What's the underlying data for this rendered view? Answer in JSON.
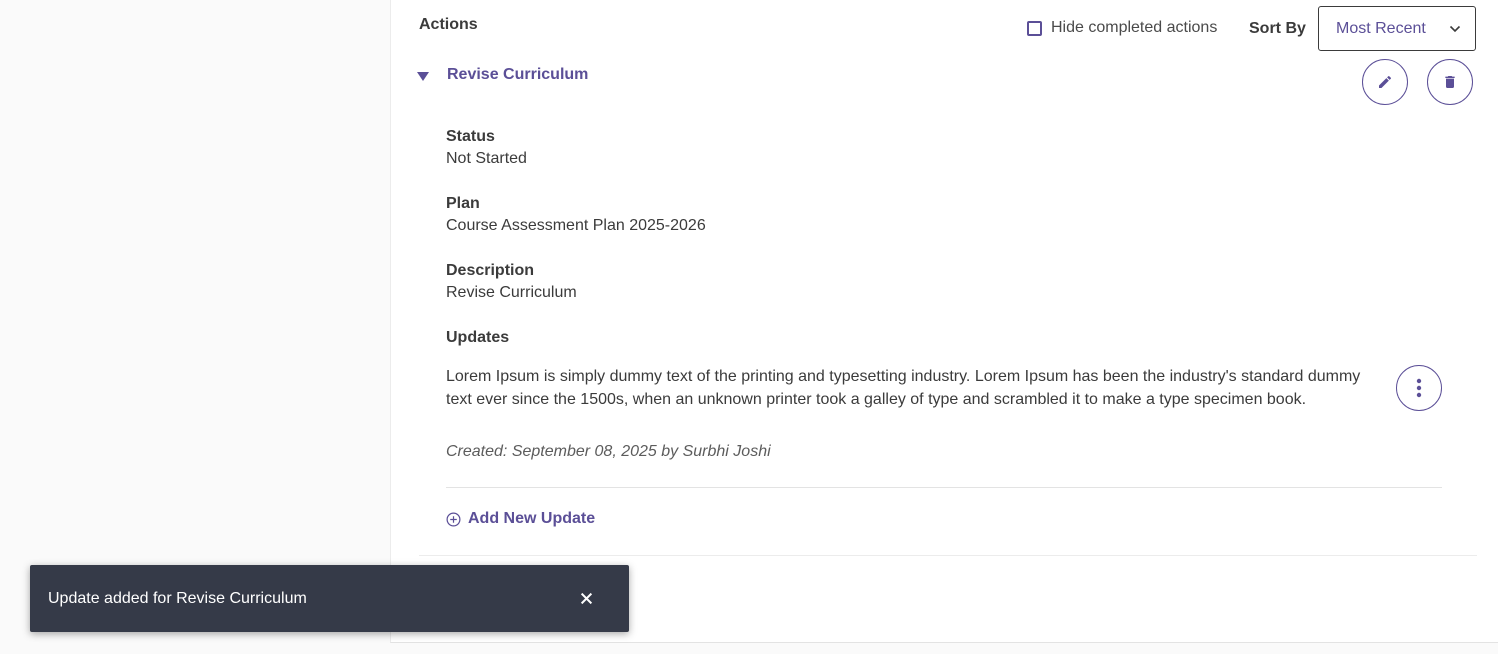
{
  "actions_section": {
    "title": "Actions",
    "hide_completed_label": "Hide completed actions",
    "hide_completed_checked": false,
    "sort_by_label": "Sort By",
    "sort_selected": "Most Recent"
  },
  "action": {
    "title": "Revise Curriculum",
    "expanded": true,
    "status_label": "Status",
    "status_value": "Not Started",
    "plan_label": "Plan",
    "plan_value": "Course Assessment Plan 2025-2026",
    "description_label": "Description",
    "description_value": "Revise Curriculum",
    "updates_label": "Updates",
    "updates": [
      {
        "text": "Lorem Ipsum is simply dummy text of the printing and typesetting industry. Lorem Ipsum has been the industry's standard dummy text ever since the 1500s, when an unknown printer took a galley of type and scrambled it to make a type specimen book.",
        "meta": "Created: September 08, 2025 by Surbhi Joshi"
      }
    ],
    "add_update_label": "Add New Update"
  },
  "toast": {
    "message": "Update added for Revise Curriculum"
  },
  "icons": {
    "edit": "pencil-icon",
    "delete": "trash-icon",
    "more": "more-vertical-icon",
    "add": "plus-circle-icon",
    "close": "close-icon",
    "dropdown": "chevron-down-icon",
    "toggle": "caret-down-icon"
  },
  "colors": {
    "accent": "#5b4f97",
    "toast_bg": "#353a48",
    "text": "#3b3b3b"
  }
}
